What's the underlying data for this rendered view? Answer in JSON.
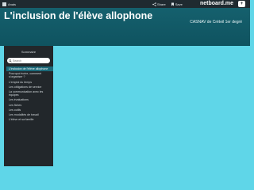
{
  "topbar": {
    "username": "Anais",
    "actions": [
      {
        "icon": "share-icon",
        "label": "Share"
      },
      {
        "icon": "bookmark-icon",
        "label": "Save"
      }
    ],
    "brand": "netboard.me",
    "brand_button": "+"
  },
  "header": {
    "title": "L'inclusion de l'élève allophone",
    "subtitle": "CASNAV de Créteil 1er degré"
  },
  "sidebar": {
    "title": "Sommaire",
    "search_placeholder": "Search",
    "items": [
      {
        "label": "L'inclusion de l'élève allophone",
        "active": true
      },
      {
        "label": "Pourquoi écrire, comment s'organiser ?",
        "active": false
      },
      {
        "label": "L'emploi du temps",
        "active": false
      },
      {
        "label": "Les obligations de service",
        "active": false
      },
      {
        "label": "La communication avec les équipes",
        "active": false
      },
      {
        "label": "Les évaluations",
        "active": false
      },
      {
        "label": "Les fiches",
        "active": false
      },
      {
        "label": "Les outils",
        "active": false
      },
      {
        "label": "Les modalités de travail",
        "active": false
      },
      {
        "label": "L'élève et sa famille",
        "active": false
      }
    ]
  },
  "colors": {
    "page_bg": "#5fd6e8",
    "header_bg": "#15606d",
    "sidebar_bg": "#22272b",
    "active_item": "#1c6a7a"
  }
}
